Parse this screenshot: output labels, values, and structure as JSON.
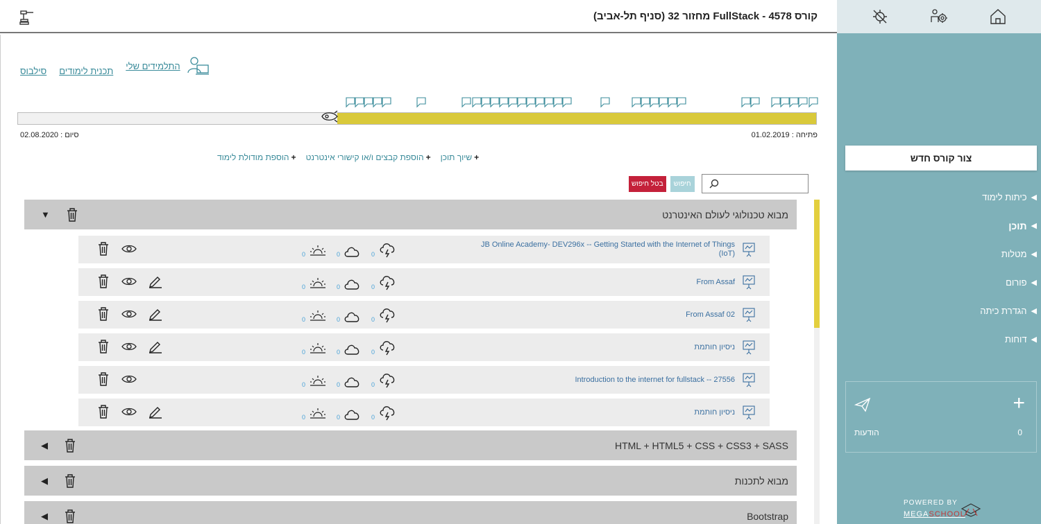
{
  "header": {
    "title": "קורס 4578 - FullStack מחזור 32 (סניף תל-אביב)"
  },
  "sidebar": {
    "new_course": "צור קורס חדש",
    "items": [
      {
        "label": "כיתות לימוד"
      },
      {
        "label": "תוכן"
      },
      {
        "label": "מטלות"
      },
      {
        "label": "פורום"
      },
      {
        "label": "הגדרת כיתה"
      },
      {
        "label": "דוחות"
      }
    ],
    "messages_label": "הודעות",
    "messages_count": "0",
    "powered_by": "POWERED BY",
    "brand_mega": "MEGA",
    "brand_school": "SCHOOL"
  },
  "top_links": {
    "students": "התלמידים שלי",
    "plan": "תכנית לימודים",
    "syllabus": "סילבוס"
  },
  "timeline": {
    "start_date": "פתיחה : 01.02.2019",
    "end_date": "סיום : 02.08.2020",
    "progress_fraction": 0.6
  },
  "actions": {
    "assign_content": "שיוך תוכן",
    "add_files": "הוספת קבצים ו/או קישורי אינטרנט",
    "add_module": "הוספת מודולת לימוד"
  },
  "search": {
    "search_btn": "חיפוש",
    "cancel_btn": "בטל חיפוש",
    "placeholder": ""
  },
  "modules": [
    {
      "title": "מבוא טכנולוגי לעולם האינטרנט",
      "expanded": true
    },
    {
      "title": "HTML + HTML5 + CSS + CSS3 + SASS",
      "expanded": false
    },
    {
      "title": "מבוא לתכנות",
      "expanded": false
    },
    {
      "title": "Bootstrap",
      "expanded": false
    }
  ],
  "lessons": [
    {
      "title": "JB Online Academy- DEV296x -- Getting Started with the Internet of Things (IoT)",
      "editable": false,
      "stat_a": "0",
      "stat_b": "0",
      "stat_c": "0"
    },
    {
      "title": "From Assaf",
      "editable": true,
      "stat_a": "0",
      "stat_b": "0",
      "stat_c": "0"
    },
    {
      "title": "From Assaf 02",
      "editable": true,
      "stat_a": "0",
      "stat_b": "0",
      "stat_c": "0"
    },
    {
      "title": "ניסיון חותמת",
      "editable": true,
      "stat_a": "0",
      "stat_b": "0",
      "stat_c": "0"
    },
    {
      "title": "Introduction to the internet for fullstack -- 27556",
      "editable": false,
      "stat_a": "0",
      "stat_b": "0",
      "stat_c": "0"
    },
    {
      "title": "ניסיון חותמת",
      "editable": true,
      "stat_a": "0",
      "stat_b": "0",
      "stat_c": "0"
    }
  ],
  "colors": {
    "sidebar": "#7fb1b9",
    "accent_yellow": "#d9c93a",
    "link": "#3a8b9a",
    "cancel_red": "#c4213a"
  }
}
